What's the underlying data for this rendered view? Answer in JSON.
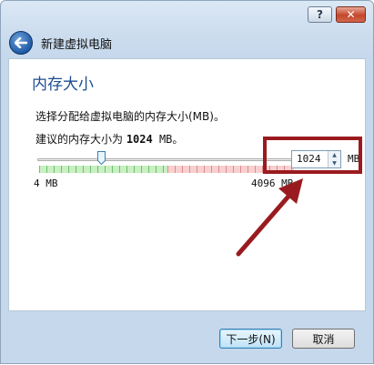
{
  "window": {
    "help_label": "?",
    "close_label": "✕"
  },
  "header": {
    "back_icon": "back-arrow-icon",
    "title": "新建虚拟电脑"
  },
  "section": {
    "title": "内存大小",
    "description": "选择分配给虚拟电脑的内存大小(MB)。",
    "recommend_prefix": "建议的内存大小为 ",
    "recommend_value": "1024",
    "recommend_suffix": " MB。"
  },
  "memory_slider": {
    "min": 4,
    "max": 4096,
    "value": 1024,
    "min_label": "4 MB",
    "max_label": "4096 MB",
    "safe_fraction": 0.5
  },
  "memory_spinbox": {
    "value": "1024",
    "unit": "MB"
  },
  "annotation": {
    "color": "#9a1b1f"
  },
  "footer": {
    "next_label": "下一步(N)",
    "cancel_label": "取消"
  }
}
